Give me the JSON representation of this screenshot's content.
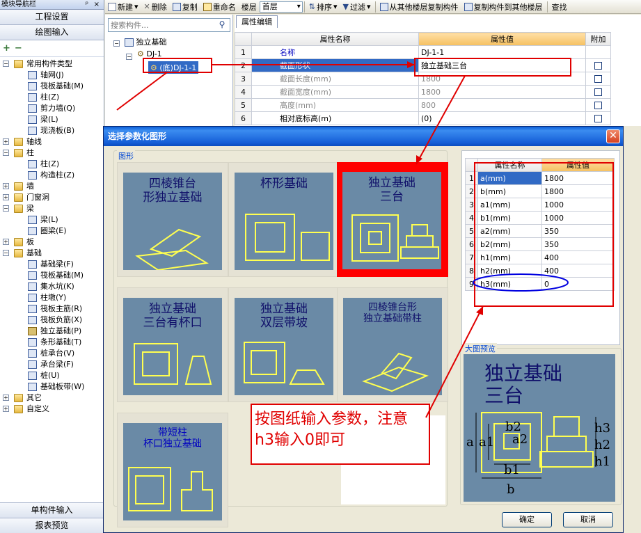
{
  "nav": {
    "title": "模块导航栏",
    "pin": "ᵖ",
    "close": "×",
    "sections": [
      "工程设置",
      "绘图输入"
    ],
    "tools": [
      "+",
      "−"
    ],
    "tree": [
      {
        "label": "常用构件类型",
        "level": 0,
        "kind": "folder",
        "open": true
      },
      {
        "label": "轴网(J)",
        "level": 1,
        "kind": "leaf"
      },
      {
        "label": "筏板基础(M)",
        "level": 1,
        "kind": "leaf"
      },
      {
        "label": "柱(Z)",
        "level": 1,
        "kind": "leaf"
      },
      {
        "label": "剪力墙(Q)",
        "level": 1,
        "kind": "leaf"
      },
      {
        "label": "梁(L)",
        "level": 1,
        "kind": "leaf"
      },
      {
        "label": "现浇板(B)",
        "level": 1,
        "kind": "leaf"
      },
      {
        "label": "轴线",
        "level": 0,
        "kind": "folder",
        "open": false
      },
      {
        "label": "柱",
        "level": 0,
        "kind": "folder",
        "open": true
      },
      {
        "label": "柱(Z)",
        "level": 1,
        "kind": "leaf"
      },
      {
        "label": "构造柱(Z)",
        "level": 1,
        "kind": "leaf"
      },
      {
        "label": "墙",
        "level": 0,
        "kind": "folder",
        "open": false
      },
      {
        "label": "门窗洞",
        "level": 0,
        "kind": "folder",
        "open": false
      },
      {
        "label": "梁",
        "level": 0,
        "kind": "folder",
        "open": true
      },
      {
        "label": "梁(L)",
        "level": 1,
        "kind": "leaf"
      },
      {
        "label": "圈梁(E)",
        "level": 1,
        "kind": "leaf"
      },
      {
        "label": "板",
        "level": 0,
        "kind": "folder",
        "open": false
      },
      {
        "label": "基础",
        "level": 0,
        "kind": "folder",
        "open": true
      },
      {
        "label": "基础梁(F)",
        "level": 1,
        "kind": "leaf"
      },
      {
        "label": "筏板基础(M)",
        "level": 1,
        "kind": "leaf"
      },
      {
        "label": "集水坑(K)",
        "level": 1,
        "kind": "leaf"
      },
      {
        "label": "柱墩(Y)",
        "level": 1,
        "kind": "leaf"
      },
      {
        "label": "筏板主筋(R)",
        "level": 1,
        "kind": "leaf"
      },
      {
        "label": "筏板负筋(X)",
        "level": 1,
        "kind": "leaf"
      },
      {
        "label": "独立基础(P)",
        "level": 1,
        "kind": "leaf",
        "selected": true
      },
      {
        "label": "条形基础(T)",
        "level": 1,
        "kind": "leaf"
      },
      {
        "label": "桩承台(V)",
        "level": 1,
        "kind": "leaf"
      },
      {
        "label": "承台梁(F)",
        "level": 1,
        "kind": "leaf"
      },
      {
        "label": "桩(U)",
        "level": 1,
        "kind": "leaf"
      },
      {
        "label": "基础板带(W)",
        "level": 1,
        "kind": "leaf"
      },
      {
        "label": "其它",
        "level": 0,
        "kind": "folder",
        "open": false
      },
      {
        "label": "自定义",
        "level": 0,
        "kind": "folder",
        "open": false
      }
    ],
    "bottom": [
      "单构件输入",
      "报表预览"
    ]
  },
  "toolbar": {
    "new": "新建",
    "delete": "删除",
    "copy": "复制",
    "rename": "重命名",
    "floor_label": "楼层",
    "floor_value": "首层",
    "sort": "排序",
    "filter": "过滤",
    "copy_from": "从其他楼层复制构件",
    "copy_to": "复制构件到其他楼层",
    "find": "查找"
  },
  "comp": {
    "search_placeholder": "搜索构件...",
    "root": "独立基础",
    "child": "DJ-1",
    "grandchild": "(底)DJ-1-1"
  },
  "props": {
    "tab": "属性编辑",
    "headers": [
      "属性名称",
      "属性值",
      "附加"
    ],
    "rows": [
      {
        "n": "1",
        "name": "名称",
        "value": "DJ-1-1",
        "style": "blue",
        "check": false
      },
      {
        "n": "2",
        "name": "截面形状",
        "value": "独立基础三台",
        "style": "sel",
        "check": true
      },
      {
        "n": "3",
        "name": "截面长度(mm)",
        "value": "1800",
        "style": "grey",
        "check": true
      },
      {
        "n": "4",
        "name": "截面宽度(mm)",
        "value": "1800",
        "style": "grey",
        "check": true
      },
      {
        "n": "5",
        "name": "高度(mm)",
        "value": "800",
        "style": "grey",
        "check": true
      },
      {
        "n": "6",
        "name": "相对底标高(m)",
        "value": "(0)",
        "style": "normal",
        "check": true
      }
    ]
  },
  "dialog": {
    "title": "选择参数化图形",
    "shapes_label": "图形",
    "preview_label": "大图预览",
    "ok": "确定",
    "cancel": "取消",
    "shapes": [
      {
        "caption": "四棱锥台\n形独立基础"
      },
      {
        "caption": "杯形基础"
      },
      {
        "caption": "独立基础\n三台"
      },
      {
        "caption": "独立基础\n三台有杯口"
      },
      {
        "caption": "独立基础\n双层带坡"
      },
      {
        "caption": "四棱锥台形\n独立基础带柱"
      },
      {
        "caption": "带短柱\n杯口独立基础"
      }
    ],
    "param_headers": [
      "属性名称",
      "属性值"
    ],
    "params": [
      {
        "n": "1",
        "name": "a(mm)",
        "value": "1800"
      },
      {
        "n": "2",
        "name": "b(mm)",
        "value": "1800"
      },
      {
        "n": "3",
        "name": "a1(mm)",
        "value": "1000"
      },
      {
        "n": "4",
        "name": "b1(mm)",
        "value": "1000"
      },
      {
        "n": "5",
        "name": "a2(mm)",
        "value": "350"
      },
      {
        "n": "6",
        "name": "b2(mm)",
        "value": "350"
      },
      {
        "n": "7",
        "name": "h1(mm)",
        "value": "400"
      },
      {
        "n": "8",
        "name": "h2(mm)",
        "value": "400"
      },
      {
        "n": "9",
        "name": "h3(mm)",
        "value": "0"
      }
    ],
    "preview_caption": "独立基础\n三台"
  },
  "note": "按图纸输入参数，注意h3输入0即可",
  "colors": {
    "annotation": "#e00000",
    "ellipse": "#0000e0",
    "accent": "#316ac5"
  }
}
